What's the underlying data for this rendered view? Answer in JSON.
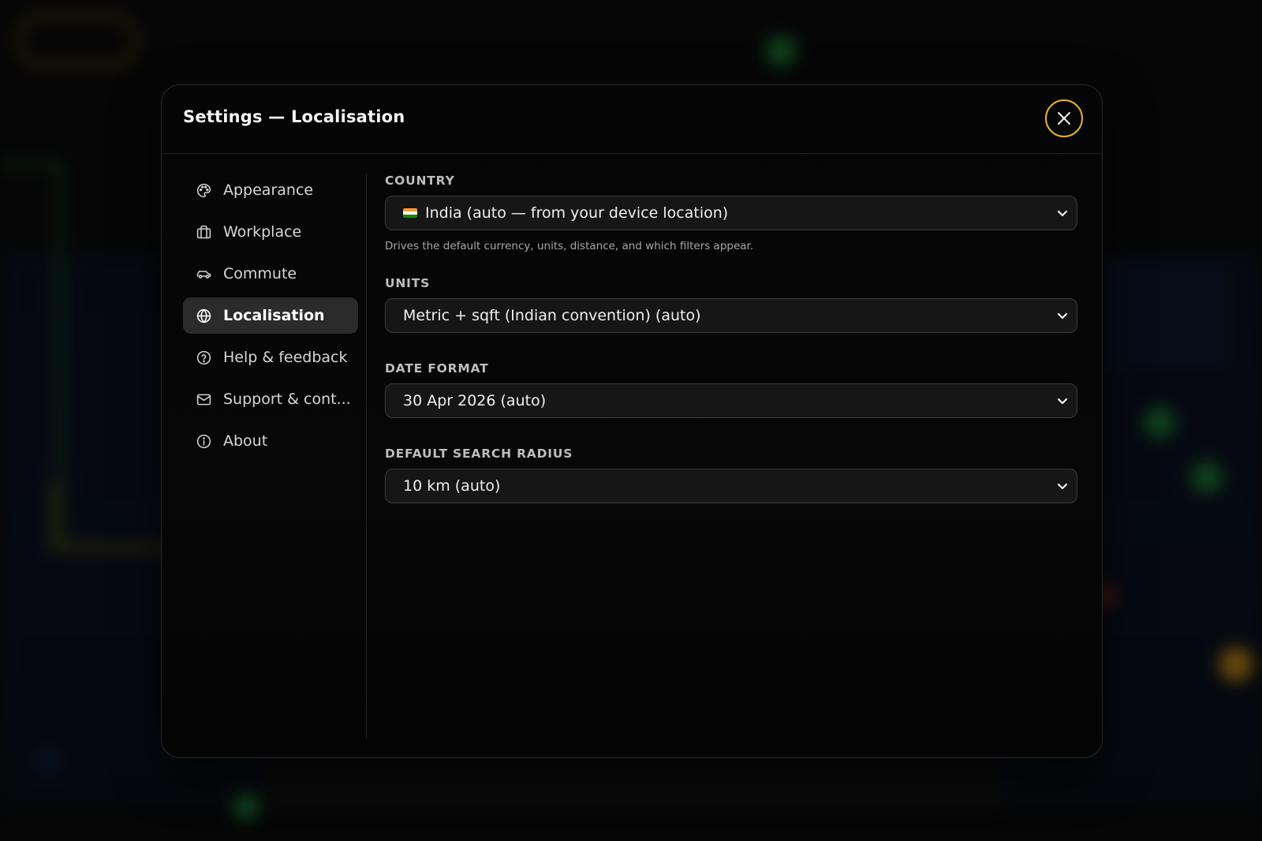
{
  "modal": {
    "title": "Settings — Localisation"
  },
  "sidebar": {
    "items": [
      {
        "label": "Appearance",
        "icon": "palette-icon",
        "active": false
      },
      {
        "label": "Workplace",
        "icon": "briefcase-icon",
        "active": false
      },
      {
        "label": "Commute",
        "icon": "car-icon",
        "active": false
      },
      {
        "label": "Localisation",
        "icon": "globe-icon",
        "active": true
      },
      {
        "label": "Help & feedback",
        "icon": "help-circle-icon",
        "active": false
      },
      {
        "label": "Support & cont...",
        "icon": "mail-icon",
        "active": false
      },
      {
        "label": "About",
        "icon": "info-icon",
        "active": false
      }
    ]
  },
  "fields": {
    "country": {
      "label": "COUNTRY",
      "value": "India (auto — from your device location)",
      "hint": "Drives the default currency, units, distance, and which filters appear."
    },
    "units": {
      "label": "UNITS",
      "value": "Metric + sqft (Indian convention) (auto)"
    },
    "date_format": {
      "label": "DATE FORMAT",
      "value": "30 Apr 2026 (auto)"
    },
    "search_radius": {
      "label": "DEFAULT SEARCH RADIUS",
      "value": "10 km (auto)"
    }
  },
  "colors": {
    "accent": "#e6b422",
    "modal_bg": "#050505",
    "active_nav_bg": "#2b2b2b",
    "select_bg": "#161616"
  }
}
